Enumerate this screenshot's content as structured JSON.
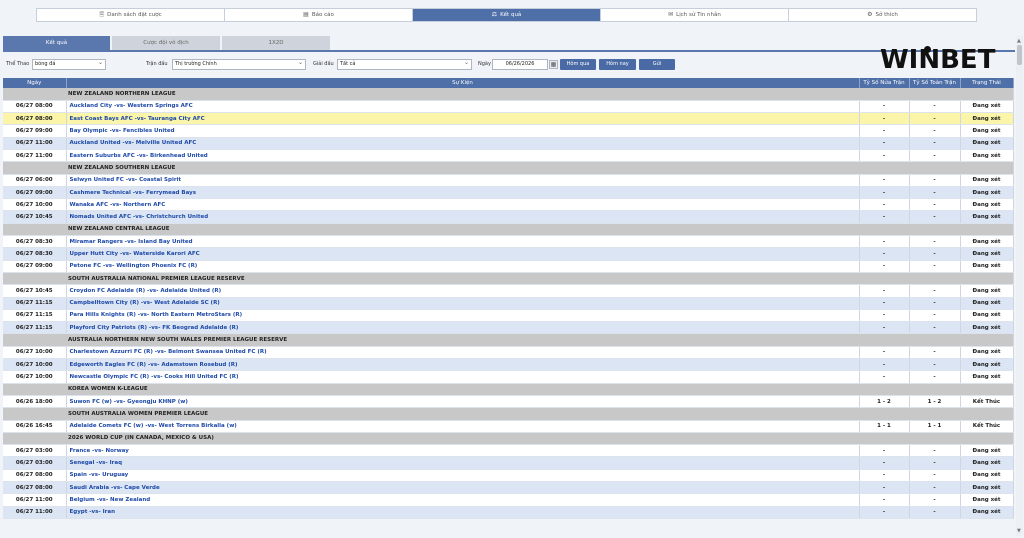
{
  "topnav": [
    {
      "icon": "🖹",
      "label": "Danh sách đặt cược",
      "active": false
    },
    {
      "icon": "▤",
      "label": "Báo cáo",
      "active": false
    },
    {
      "icon": "⚖",
      "label": "Kết quả",
      "active": true
    },
    {
      "icon": "✉",
      "label": "Lịch sử Tin nhắn",
      "active": false
    },
    {
      "icon": "⚙",
      "label": "Sở thích",
      "active": false
    }
  ],
  "subtabs": [
    "Kết quả",
    "Cược đội vô địch",
    "1X2D"
  ],
  "filters": {
    "sport_label": "Thể Thao",
    "sport_value": "bóng đá",
    "match_label": "Trận đấu",
    "match_value": "Thị trường Chính",
    "league_label": "Giải đấu",
    "league_value": "Tất cả",
    "date_label": "Ngày",
    "date_value": "06/26/2026",
    "yesterday_btn": "Hôm qua",
    "today_btn": "Hôm nay",
    "submit_btn": "Gửi"
  },
  "logo": "WINBET",
  "table": {
    "headers": [
      "Ngày",
      "Sự Kiện",
      "Tỷ Số Nửa Trận",
      "Tỷ Số Toàn Trận",
      "Trạng Thái"
    ],
    "rows": [
      {
        "league": "NEW ZEALAND NORTHERN LEAGUE"
      },
      {
        "date": "06/27 08:00",
        "event": "Auckland City -vs- Western Springs AFC",
        "half": "-",
        "full": "-",
        "status": "Đang xét"
      },
      {
        "date": "06/27 08:00",
        "event": "East Coast Bays AFC -vs- Tauranga City AFC",
        "half": "-",
        "full": "-",
        "status": "Đang xét",
        "highlight": true
      },
      {
        "date": "06/27 09:00",
        "event": "Bay Olympic -vs- Fencibles United",
        "half": "-",
        "full": "-",
        "status": "Đang xét"
      },
      {
        "date": "06/27 11:00",
        "event": "Auckland United -vs- Melville United AFC",
        "half": "-",
        "full": "-",
        "status": "Đang xét"
      },
      {
        "date": "06/27 11:00",
        "event": "Eastern Suburbs AFC -vs- Birkenhead United",
        "half": "-",
        "full": "-",
        "status": "Đang xét"
      },
      {
        "league": "NEW ZEALAND SOUTHERN LEAGUE"
      },
      {
        "date": "06/27 06:00",
        "event": "Selwyn United FC -vs- Coastal Spirit",
        "half": "-",
        "full": "-",
        "status": "Đang xét"
      },
      {
        "date": "06/27 09:00",
        "event": "Cashmere Technical -vs- Ferrymead Bays",
        "half": "-",
        "full": "-",
        "status": "Đang xét"
      },
      {
        "date": "06/27 10:00",
        "event": "Wanaka AFC -vs- Northern AFC",
        "half": "-",
        "full": "-",
        "status": "Đang xét"
      },
      {
        "date": "06/27 10:45",
        "event": "Nomads United AFC -vs- Christchurch United",
        "half": "-",
        "full": "-",
        "status": "Đang xét"
      },
      {
        "league": "NEW ZEALAND CENTRAL LEAGUE"
      },
      {
        "date": "06/27 08:30",
        "event": "Miramar Rangers -vs- Island Bay United",
        "half": "-",
        "full": "-",
        "status": "Đang xét"
      },
      {
        "date": "06/27 08:30",
        "event": "Upper Hutt City -vs- Waterside Karori AFC",
        "half": "-",
        "full": "-",
        "status": "Đang xét"
      },
      {
        "date": "06/27 09:00",
        "event": "Petone FC -vs- Wellington Phoenix FC (R)",
        "half": "-",
        "full": "-",
        "status": "Đang xét"
      },
      {
        "league": "SOUTH AUSTRALIA NATIONAL PREMIER LEAGUE RESERVE"
      },
      {
        "date": "06/27 10:45",
        "event": "Croydon FC Adelaide (R) -vs- Adelaide United (R)",
        "half": "-",
        "full": "-",
        "status": "Đang xét"
      },
      {
        "date": "06/27 11:15",
        "event": "Campbelltown City (R) -vs- West Adelaide SC (R)",
        "half": "-",
        "full": "-",
        "status": "Đang xét"
      },
      {
        "date": "06/27 11:15",
        "event": "Para Hills Knights (R) -vs- North Eastern MetroStars (R)",
        "half": "-",
        "full": "-",
        "status": "Đang xét"
      },
      {
        "date": "06/27 11:15",
        "event": "Playford City Patriots (R) -vs- FK Beograd Adelaide (R)",
        "half": "-",
        "full": "-",
        "status": "Đang xét"
      },
      {
        "league": "AUSTRALIA NORTHERN NEW SOUTH WALES PREMIER LEAGUE RESERVE"
      },
      {
        "date": "06/27 10:00",
        "event": "Charlestown Azzurri FC (R) -vs- Belmont Swansea United FC (R)",
        "half": "-",
        "full": "-",
        "status": "Đang xét"
      },
      {
        "date": "06/27 10:00",
        "event": "Edgeworth Eagles FC (R) -vs- Adamstown Rosebud (R)",
        "half": "-",
        "full": "-",
        "status": "Đang xét"
      },
      {
        "date": "06/27 10:00",
        "event": "Newcastle Olympic FC (R) -vs- Cooks Hill United FC (R)",
        "half": "-",
        "full": "-",
        "status": "Đang xét"
      },
      {
        "league": "KOREA WOMEN K-LEAGUE"
      },
      {
        "date": "06/26 18:00",
        "event": "Suwon FC (w) -vs- Gyeongju KHNP (w)",
        "half": "1 - 2",
        "full": "1 - 2",
        "status": "Kết Thúc"
      },
      {
        "league": "SOUTH AUSTRALIA WOMEN PREMIER LEAGUE"
      },
      {
        "date": "06/26 16:45",
        "event": "Adelaide Comets FC (w) -vs- West Torrens Birkalla (w)",
        "half": "1 - 1",
        "full": "1 - 1",
        "status": "Kết Thúc"
      },
      {
        "league": "2026 WORLD CUP (IN CANADA, MEXICO & USA)"
      },
      {
        "date": "06/27 03:00",
        "event": "France -vs- Norway",
        "half": "-",
        "full": "-",
        "status": "Đang xét"
      },
      {
        "date": "06/27 03:00",
        "event": "Senegal -vs- Iraq",
        "half": "-",
        "full": "-",
        "status": "Đang xét"
      },
      {
        "date": "06/27 08:00",
        "event": "Spain -vs- Uruguay",
        "half": "-",
        "full": "-",
        "status": "Đang xét"
      },
      {
        "date": "06/27 08:00",
        "event": "Saudi Arabia -vs- Cape Verde",
        "half": "-",
        "full": "-",
        "status": "Đang xét"
      },
      {
        "date": "06/27 11:00",
        "event": "Belgium -vs- New Zealand",
        "half": "-",
        "full": "-",
        "status": "Đang xét"
      },
      {
        "date": "06/27 11:00",
        "event": "Egypt -vs- Iran",
        "half": "-",
        "full": "-",
        "status": "Đang xét"
      }
    ]
  }
}
